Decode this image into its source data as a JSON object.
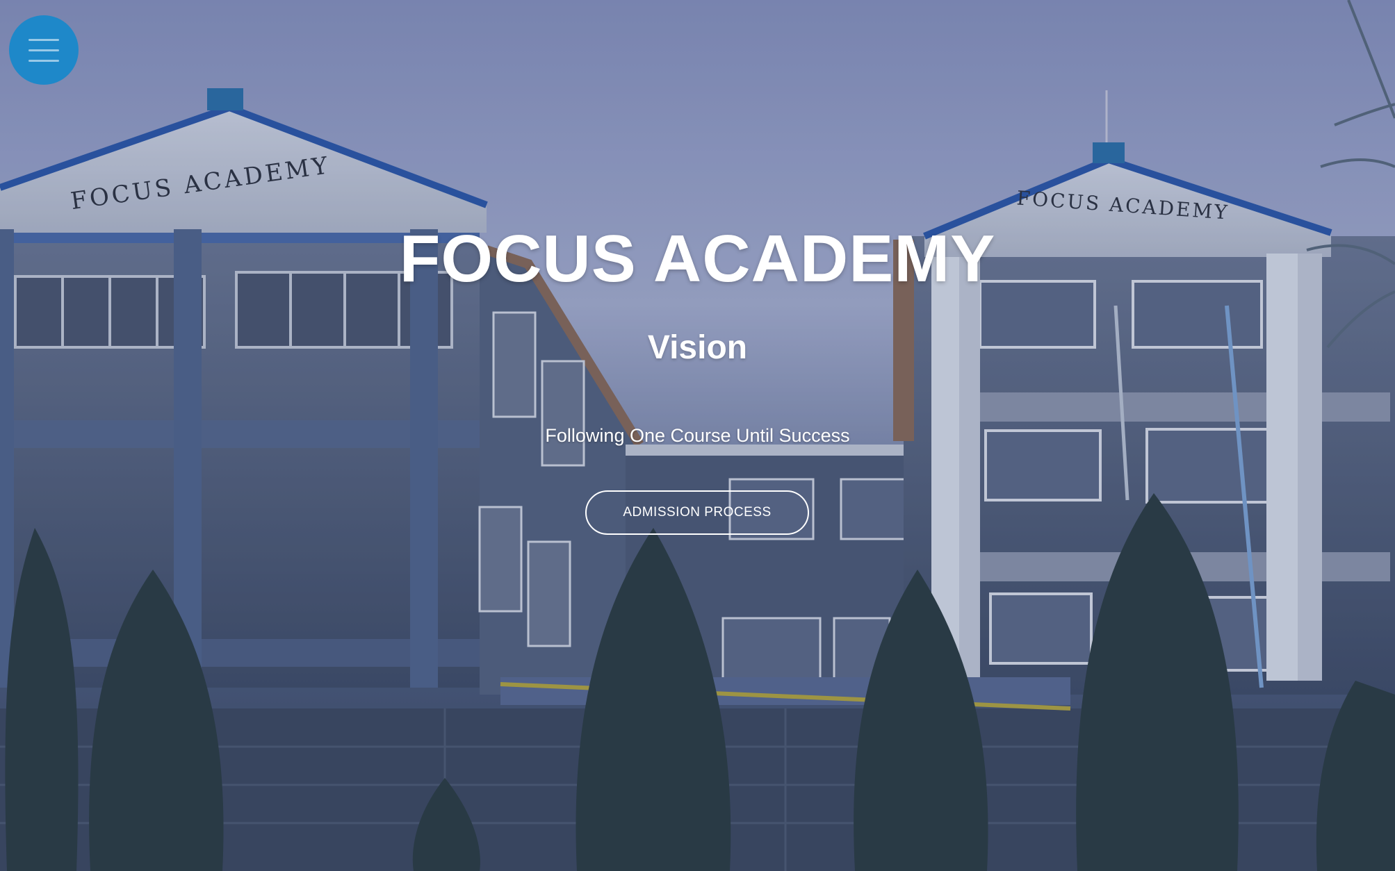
{
  "menu": {
    "icon": "hamburger-menu-icon",
    "color": "#1e88c9"
  },
  "hero": {
    "title": "FOCUS ACADEMY",
    "subtitle": "Vision",
    "motto": "Following One Course Until Success",
    "cta_label": "ADMISSION PROCESS",
    "background": {
      "icon": "school-building-photo",
      "building_sign": "FOCUS ACADEMY"
    }
  }
}
